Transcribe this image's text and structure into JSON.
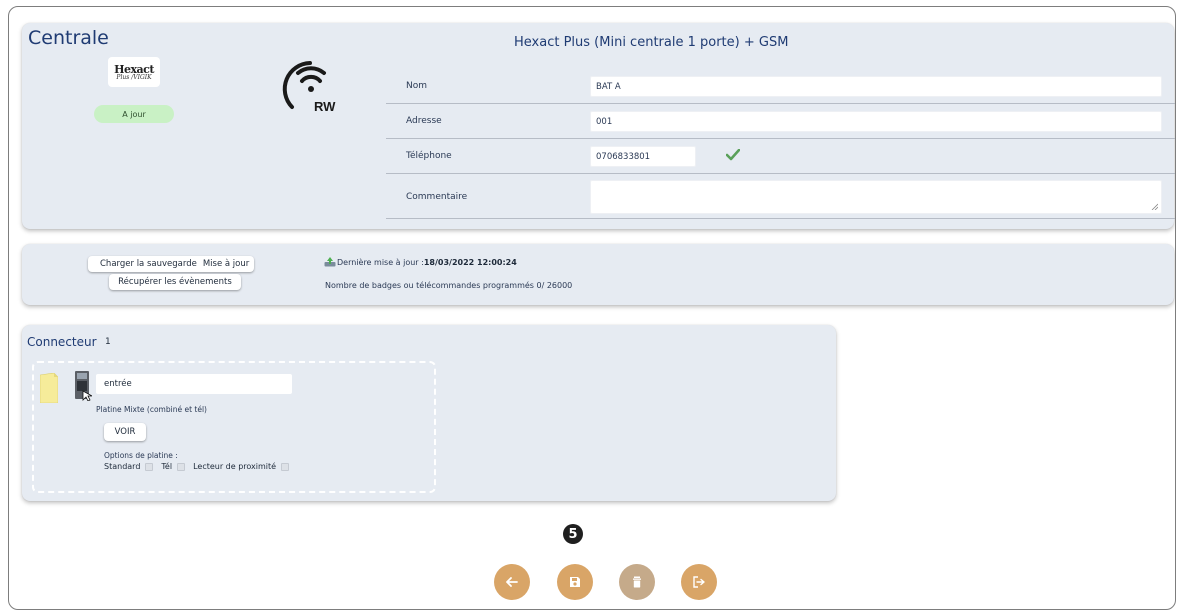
{
  "centrale": {
    "title": "Centrale",
    "device_name": "Hexact Plus (Mini centrale 1 porte) + GSM",
    "logo_line1": "Hexact",
    "logo_line2": "Plus /VIGIK",
    "status": "A jour",
    "wifi_label": "RW",
    "fields": {
      "nom_label": "Nom",
      "nom_value": "BAT A",
      "adresse_label": "Adresse",
      "adresse_value": "001",
      "telephone_label": "Téléphone",
      "telephone_value": "0706833801",
      "commentaire_label": "Commentaire",
      "commentaire_value": ""
    }
  },
  "sauvegarde": {
    "charger_label": "Charger la sauvegarde",
    "mise_a_jour_label": "Mise à jour",
    "recuperer_label": "Récupérer les évènements",
    "last_update_prefix": "Dernière mise à jour : ",
    "last_update_value": "18/03/2022 12:00:24",
    "badges_text": "Nombre de badges ou télécommandes programmés 0/ 26000"
  },
  "connecteur": {
    "title": "Connecteur",
    "number": "1",
    "slot": {
      "name_value": "entrée",
      "type": "Platine Mixte (combiné et tél)",
      "voir_label": "VOIR",
      "options_label": "Options de platine :",
      "options": [
        "Standard",
        "Tél",
        "Lecteur de proximité"
      ]
    }
  },
  "step_badge": "5",
  "actions": [
    "back-icon",
    "save-icon",
    "delete-icon",
    "exit-icon"
  ],
  "colors": {
    "card_bg": "#e6ebf2",
    "title_blue": "#1f3b73",
    "status_green": "#c9f1c5",
    "action_orange": "#d9a567",
    "action_disabled": "#c5aa8a"
  }
}
